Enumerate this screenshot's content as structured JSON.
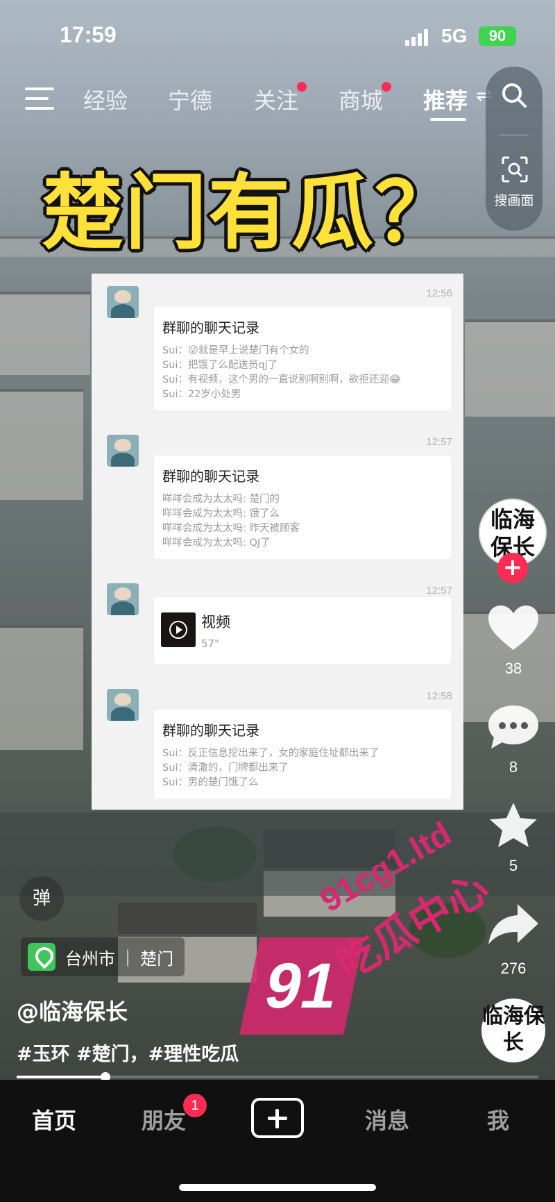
{
  "status_bar": {
    "time": "17:59",
    "network": "5G",
    "battery": "90"
  },
  "top_nav": {
    "tabs": [
      {
        "label": "经验",
        "active": false,
        "dot": false
      },
      {
        "label": "宁德",
        "active": false,
        "dot": false
      },
      {
        "label": "关注",
        "active": false,
        "dot": true
      },
      {
        "label": "商城",
        "active": false,
        "dot": true
      },
      {
        "label": "推荐",
        "active": true,
        "dot": false
      }
    ],
    "search_label": "搜画面"
  },
  "video": {
    "headline": "楚门有瓜？",
    "chat": [
      {
        "time": "12:56",
        "type": "record",
        "title": "群聊的聊天记录",
        "lines": [
          "Sui：😜就是早上说楚门有个女的",
          "Sui：把饿了么配送员qj了",
          "Sui：有视频，这个男的一直说别啊别啊，欲拒还迎😂",
          "Sui：22岁小处男"
        ]
      },
      {
        "time": "12:57",
        "type": "record",
        "title": "群聊的聊天记录",
        "lines": [
          "咩咩会成为太太吗: 楚门的",
          "咩咩会成为太太吗: 饿了么",
          "咩咩会成为太太吗: 昨天被顾客",
          "咩咩会成为太太吗: QJ了"
        ]
      },
      {
        "time": "12:57",
        "type": "video",
        "title": "视频",
        "duration": "57\""
      },
      {
        "time": "12:58",
        "type": "record",
        "title": "群聊的聊天记录",
        "lines": [
          "Sui：反正信息挖出来了，女的家庭住址都出来了",
          "Sui：清潵的，门牌都出来了",
          "Sui：男的楚门饿了么"
        ]
      }
    ],
    "danmu_label": "弹",
    "location": {
      "city": "台州市",
      "place": "楚门"
    },
    "author": "@临海保长",
    "hashtags": "#玉环 #楚门，#理性吃瓜",
    "progress": 0.17
  },
  "right_rail": {
    "author_avatar_text": "临海保长",
    "like_count": "38",
    "comment_count": "8",
    "favorite_count": "5",
    "share_count": "276",
    "music_disc_text": "临海保长"
  },
  "watermark": {
    "number": "91",
    "url": "91cg1.ltd",
    "text": "吃瓜中心"
  },
  "bottom_nav": {
    "items": [
      "首页",
      "朋友",
      "消息",
      "我"
    ],
    "friends_badge": "1"
  },
  "colors": {
    "accent": "#fe2c55",
    "headline_yellow": "#ffe13a",
    "location_green": "#3fc55a",
    "watermark_pink": "#d62970"
  }
}
